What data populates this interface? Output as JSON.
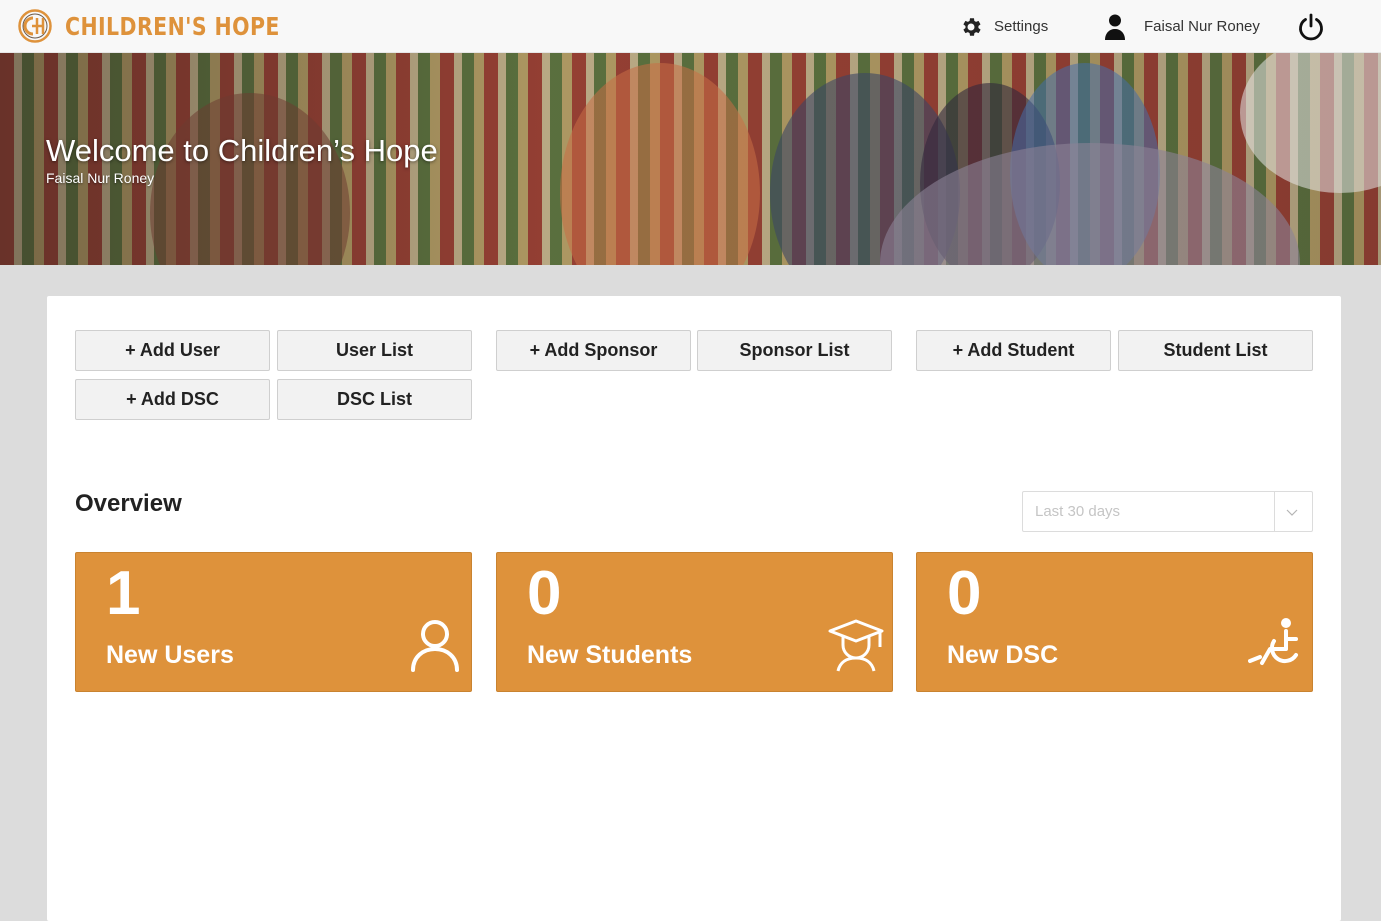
{
  "brand": {
    "name": "CHILDREN'S HOPE",
    "accent": "#de923b"
  },
  "nav": {
    "settings_label": "Settings",
    "user_name": "Faisal Nur Roney"
  },
  "hero": {
    "title": "Welcome to Children’s Hope",
    "subtitle": "Faisal Nur Roney"
  },
  "actions": {
    "add_user": "+ Add User",
    "user_list": "User List",
    "add_dsc": "+ Add DSC",
    "dsc_list": "DSC List",
    "add_sponsor": "+ Add Sponsor",
    "sponsor_list": "Sponsor List",
    "add_student": "+ Add Student",
    "student_list": "Student List"
  },
  "overview": {
    "title": "Overview",
    "range_placeholder": "Last 30 days",
    "cards": [
      {
        "value": "1",
        "label": "New Users",
        "icon": "user-icon"
      },
      {
        "value": "0",
        "label": "New Students",
        "icon": "graduate-icon"
      },
      {
        "value": "0",
        "label": "New DSC",
        "icon": "wheelchair-icon"
      }
    ]
  }
}
